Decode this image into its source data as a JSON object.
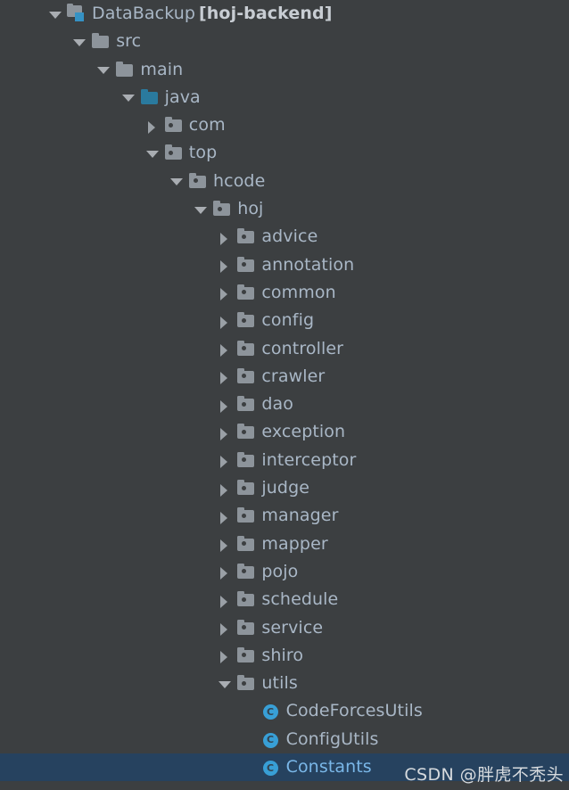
{
  "theme": {
    "background": "#3c3f41",
    "text": "#a9b7c6",
    "selected_background": "#26425f",
    "selected_text": "#7ab7e8",
    "folder_color": "#8d949b",
    "source_folder_color": "#2a7a9e",
    "module_badge_color": "#3592c4",
    "class_icon_color": "#389fd6"
  },
  "watermark": {
    "text": "CSDN @胖虎不秃头"
  },
  "tree": {
    "rows": [
      {
        "label": "DataBackup",
        "module_tag": "[hoj-backend]",
        "icon": "module-folder-icon",
        "state": "expanded",
        "depth": 0,
        "selected": false
      },
      {
        "label": "src",
        "icon": "folder-icon",
        "state": "expanded",
        "depth": 1,
        "selected": false
      },
      {
        "label": "main",
        "icon": "folder-icon",
        "state": "expanded",
        "depth": 2,
        "selected": false
      },
      {
        "label": "java",
        "icon": "source-folder-icon",
        "state": "expanded",
        "depth": 3,
        "selected": false
      },
      {
        "label": "com",
        "icon": "package-folder-icon",
        "state": "collapsed",
        "depth": 4,
        "selected": false
      },
      {
        "label": "top",
        "icon": "package-folder-icon",
        "state": "expanded",
        "depth": 4,
        "selected": false
      },
      {
        "label": "hcode",
        "icon": "package-folder-icon",
        "state": "expanded",
        "depth": 5,
        "selected": false
      },
      {
        "label": "hoj",
        "icon": "package-folder-icon",
        "state": "expanded",
        "depth": 6,
        "selected": false
      },
      {
        "label": "advice",
        "icon": "package-folder-icon",
        "state": "collapsed",
        "depth": 7,
        "selected": false
      },
      {
        "label": "annotation",
        "icon": "package-folder-icon",
        "state": "collapsed",
        "depth": 7,
        "selected": false
      },
      {
        "label": "common",
        "icon": "package-folder-icon",
        "state": "collapsed",
        "depth": 7,
        "selected": false
      },
      {
        "label": "config",
        "icon": "package-folder-icon",
        "state": "collapsed",
        "depth": 7,
        "selected": false
      },
      {
        "label": "controller",
        "icon": "package-folder-icon",
        "state": "collapsed",
        "depth": 7,
        "selected": false
      },
      {
        "label": "crawler",
        "icon": "package-folder-icon",
        "state": "collapsed",
        "depth": 7,
        "selected": false
      },
      {
        "label": "dao",
        "icon": "package-folder-icon",
        "state": "collapsed",
        "depth": 7,
        "selected": false
      },
      {
        "label": "exception",
        "icon": "package-folder-icon",
        "state": "collapsed",
        "depth": 7,
        "selected": false
      },
      {
        "label": "interceptor",
        "icon": "package-folder-icon",
        "state": "collapsed",
        "depth": 7,
        "selected": false
      },
      {
        "label": "judge",
        "icon": "package-folder-icon",
        "state": "collapsed",
        "depth": 7,
        "selected": false
      },
      {
        "label": "manager",
        "icon": "package-folder-icon",
        "state": "collapsed",
        "depth": 7,
        "selected": false
      },
      {
        "label": "mapper",
        "icon": "package-folder-icon",
        "state": "collapsed",
        "depth": 7,
        "selected": false
      },
      {
        "label": "pojo",
        "icon": "package-folder-icon",
        "state": "collapsed",
        "depth": 7,
        "selected": false
      },
      {
        "label": "schedule",
        "icon": "package-folder-icon",
        "state": "collapsed",
        "depth": 7,
        "selected": false
      },
      {
        "label": "service",
        "icon": "package-folder-icon",
        "state": "collapsed",
        "depth": 7,
        "selected": false
      },
      {
        "label": "shiro",
        "icon": "package-folder-icon",
        "state": "collapsed",
        "depth": 7,
        "selected": false
      },
      {
        "label": "utils",
        "icon": "package-folder-icon",
        "state": "expanded",
        "depth": 7,
        "selected": false
      },
      {
        "label": "CodeForcesUtils",
        "icon": "java-class-icon",
        "icon_letter": "C",
        "state": "leaf",
        "depth": 8,
        "selected": false
      },
      {
        "label": "ConfigUtils",
        "icon": "java-class-icon",
        "icon_letter": "C",
        "state": "leaf",
        "depth": 8,
        "selected": false
      },
      {
        "label": "Constants",
        "icon": "java-class-icon",
        "icon_letter": "C",
        "state": "leaf",
        "depth": 8,
        "selected": true
      }
    ]
  }
}
